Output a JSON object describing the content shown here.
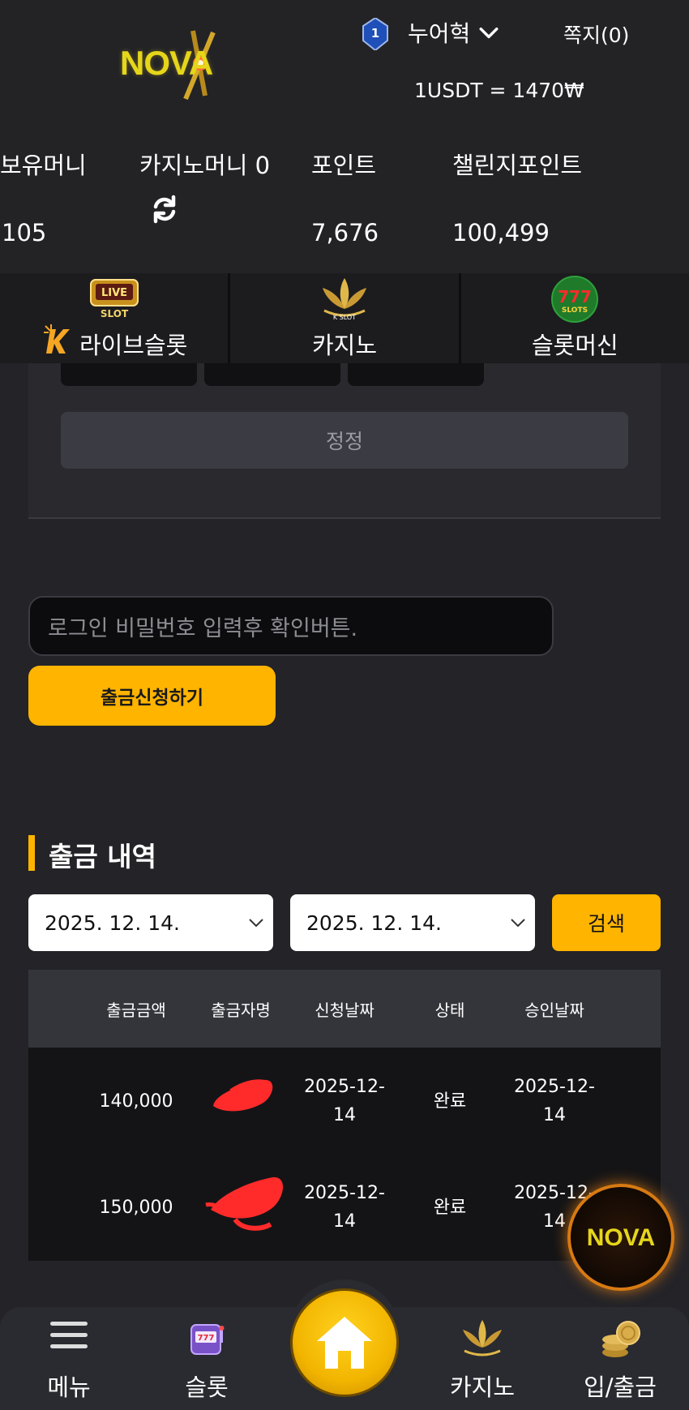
{
  "brand": {
    "logo_text": "NOVA"
  },
  "header": {
    "level": "1",
    "username": "누어혁",
    "messages": "쪽지(0)",
    "exchange_rate": "1USDT = 1470₩"
  },
  "balances": {
    "money_label": "보유머니",
    "money_value": "105",
    "casino_label": "카지노머니 0",
    "point_label": "포인트",
    "point_value": "7,676",
    "challenge_label": "챌린지포인트",
    "challenge_value": "100,499"
  },
  "categories": [
    {
      "label": "라이브슬롯",
      "icon": "live-slot-icon"
    },
    {
      "label": "카지노",
      "icon": "kslot-lotus-icon"
    },
    {
      "label": "슬롯머신",
      "icon": "777-slots-icon"
    }
  ],
  "form": {
    "reset_label": "정정",
    "password_placeholder": "로그인 비밀번호 입력후 확인버튼.",
    "withdraw_label": "출금신청하기"
  },
  "history": {
    "title": "출금 내역",
    "date_from": "2025. 12. 14.",
    "date_to": "2025. 12. 14.",
    "search_label": "검색",
    "headers": [
      "출금금액",
      "출금자명",
      "신청날짜",
      "상태",
      "승인날짜"
    ],
    "rows": [
      {
        "amount": "140,000",
        "name": "",
        "request_date_1": "2025-12-",
        "request_date_2": "14",
        "status": "완료",
        "approve_date_1": "2025-12-",
        "approve_date_2": "14"
      },
      {
        "amount": "150,000",
        "name": "",
        "request_date_1": "2025-12-",
        "request_date_2": "14",
        "status": "완료",
        "approve_date_1": "2025-12-",
        "approve_date_2": "14"
      }
    ]
  },
  "bottom_nav": {
    "menu": "메뉴",
    "slot": "슬롯",
    "casino": "카지노",
    "banking": "입/출금"
  },
  "colors": {
    "accent": "#ffb400",
    "background": "#232328",
    "table_head": "#34353b"
  }
}
